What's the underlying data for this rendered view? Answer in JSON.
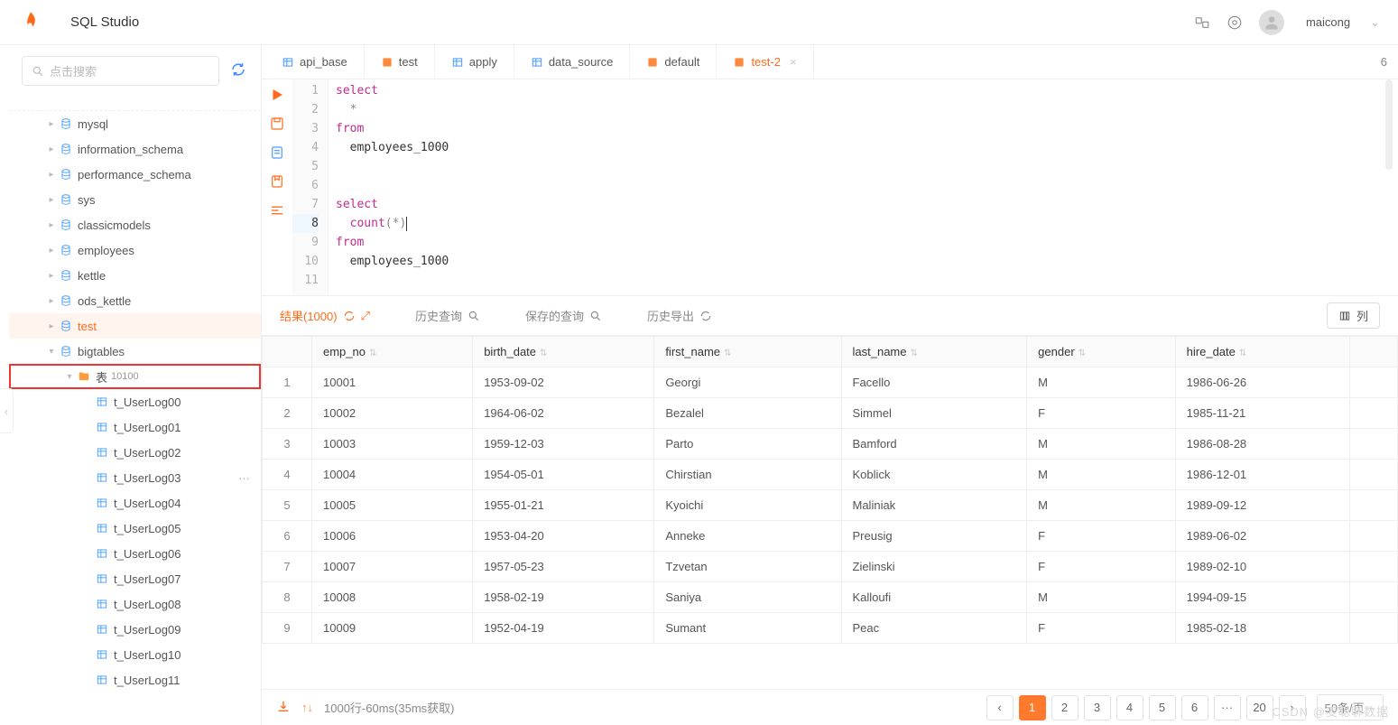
{
  "header": {
    "app_title": "SQL Studio",
    "username": "maicong"
  },
  "search": {
    "placeholder": "点击搜索"
  },
  "tree": {
    "top_cut": "mysql ...",
    "databases": [
      {
        "name": "mysql"
      },
      {
        "name": "information_schema"
      },
      {
        "name": "performance_schema"
      },
      {
        "name": "sys"
      },
      {
        "name": "classicmodels"
      },
      {
        "name": "employees"
      },
      {
        "name": "kettle"
      },
      {
        "name": "ods_kettle"
      },
      {
        "name": "test",
        "selected": true
      },
      {
        "name": "bigtables",
        "expanded": true
      }
    ],
    "tables_folder": {
      "label": "表",
      "count": "10100"
    },
    "tables": [
      "t_UserLog00",
      "t_UserLog01",
      "t_UserLog02",
      "t_UserLog03",
      "t_UserLog04",
      "t_UserLog05",
      "t_UserLog06",
      "t_UserLog07",
      "t_UserLog08",
      "t_UserLog09",
      "t_UserLog10",
      "t_UserLog11"
    ]
  },
  "tabs": {
    "items": [
      {
        "label": "api_base",
        "icon": "table"
      },
      {
        "label": "test",
        "icon": "sql"
      },
      {
        "label": "apply",
        "icon": "table"
      },
      {
        "label": "data_source",
        "icon": "table"
      },
      {
        "label": "default",
        "icon": "sql"
      },
      {
        "label": "test-2",
        "icon": "sql",
        "active": true,
        "closeable": true
      }
    ],
    "count": "6"
  },
  "editor": {
    "lines": [
      {
        "n": 1,
        "tokens": [
          [
            "kw",
            "select"
          ]
        ]
      },
      {
        "n": 2,
        "tokens": [
          [
            "txt",
            "  "
          ],
          [
            "op",
            "*"
          ]
        ]
      },
      {
        "n": 3,
        "tokens": [
          [
            "kw",
            "from"
          ]
        ]
      },
      {
        "n": 4,
        "tokens": [
          [
            "txt",
            "  employees_1000"
          ]
        ]
      },
      {
        "n": 5,
        "tokens": []
      },
      {
        "n": 6,
        "tokens": []
      },
      {
        "n": 7,
        "tokens": [
          [
            "kw",
            "select"
          ]
        ]
      },
      {
        "n": 8,
        "tokens": [
          [
            "txt",
            "  "
          ],
          [
            "fn",
            "count"
          ],
          [
            "op",
            "("
          ],
          [
            "op",
            "*"
          ],
          [
            "op",
            ")"
          ]
        ],
        "active": true,
        "cursor": true
      },
      {
        "n": 9,
        "tokens": [
          [
            "kw",
            "from"
          ]
        ]
      },
      {
        "n": 10,
        "tokens": [
          [
            "txt",
            "  employees_1000"
          ]
        ]
      },
      {
        "n": 11,
        "tokens": []
      }
    ]
  },
  "result_tabs": {
    "result": "结果(1000)",
    "history": "历史查询",
    "saved": "保存的查询",
    "export": "历史导出",
    "columns_btn": "列"
  },
  "table": {
    "columns": [
      "emp_no",
      "birth_date",
      "first_name",
      "last_name",
      "gender",
      "hire_date"
    ],
    "rows": [
      [
        "1",
        "10001",
        "1953-09-02",
        "Georgi",
        "Facello",
        "M",
        "1986-06-26"
      ],
      [
        "2",
        "10002",
        "1964-06-02",
        "Bezalel",
        "Simmel",
        "F",
        "1985-11-21"
      ],
      [
        "3",
        "10003",
        "1959-12-03",
        "Parto",
        "Bamford",
        "M",
        "1986-08-28"
      ],
      [
        "4",
        "10004",
        "1954-05-01",
        "Chirstian",
        "Koblick",
        "M",
        "1986-12-01"
      ],
      [
        "5",
        "10005",
        "1955-01-21",
        "Kyoichi",
        "Maliniak",
        "M",
        "1989-09-12"
      ],
      [
        "6",
        "10006",
        "1953-04-20",
        "Anneke",
        "Preusig",
        "F",
        "1989-06-02"
      ],
      [
        "7",
        "10007",
        "1957-05-23",
        "Tzvetan",
        "Zielinski",
        "F",
        "1989-02-10"
      ],
      [
        "8",
        "10008",
        "1958-02-19",
        "Saniya",
        "Kalloufi",
        "M",
        "1994-09-15"
      ],
      [
        "9",
        "10009",
        "1952-04-19",
        "Sumant",
        "Peac",
        "F",
        "1985-02-18"
      ]
    ]
  },
  "footer": {
    "stats": "1000行-60ms(35ms获取)",
    "pages": [
      "1",
      "2",
      "3",
      "4",
      "5",
      "6",
      "···",
      "20"
    ],
    "active_page": "1",
    "pagesize": "50条/页"
  },
  "watermark": "CSDN @麦聪聊数据"
}
